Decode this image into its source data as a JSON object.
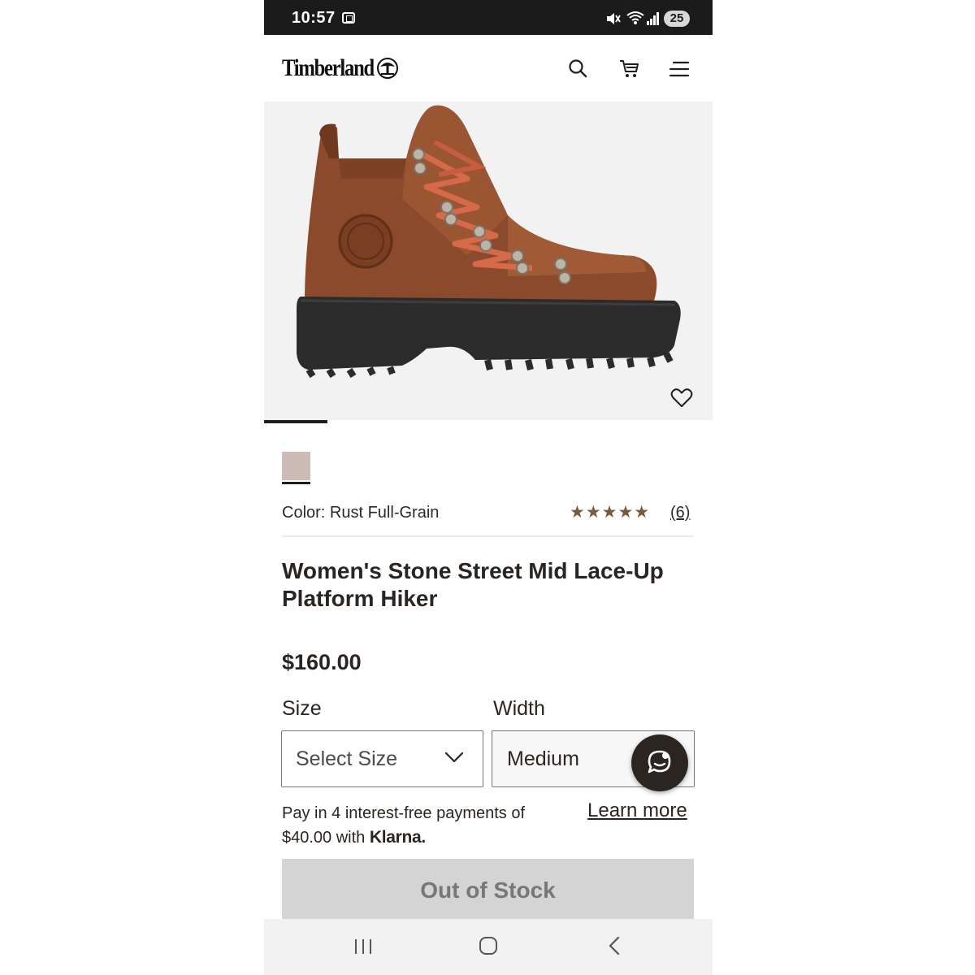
{
  "status_bar": {
    "time": "10:57",
    "battery": "25"
  },
  "header": {
    "brand": "Timberland"
  },
  "product": {
    "color_label": "Color: Rust Full-Grain",
    "rating_stars": "★★★★★",
    "rating_value": 5,
    "review_count": "(6)",
    "title": "Women's Stone Street Mid Lace-Up Platform Hiker",
    "price": "$160.00"
  },
  "options": {
    "size_label": "Size",
    "size_value": "Select Size",
    "width_label": "Width",
    "width_value": "Medium"
  },
  "klarna": {
    "text_line1": "Pay in 4 interest-free payments of",
    "text_line2": "$40.00 with",
    "brand": "Klarna.",
    "learn_more": "Learn more"
  },
  "cta": {
    "label": "Out of Stock"
  },
  "colors": {
    "swatch": "#cdbcb6",
    "star": "#7a5a3c",
    "disabled_button": "#d4d4d4"
  },
  "carousel": {
    "active_index": 1
  }
}
